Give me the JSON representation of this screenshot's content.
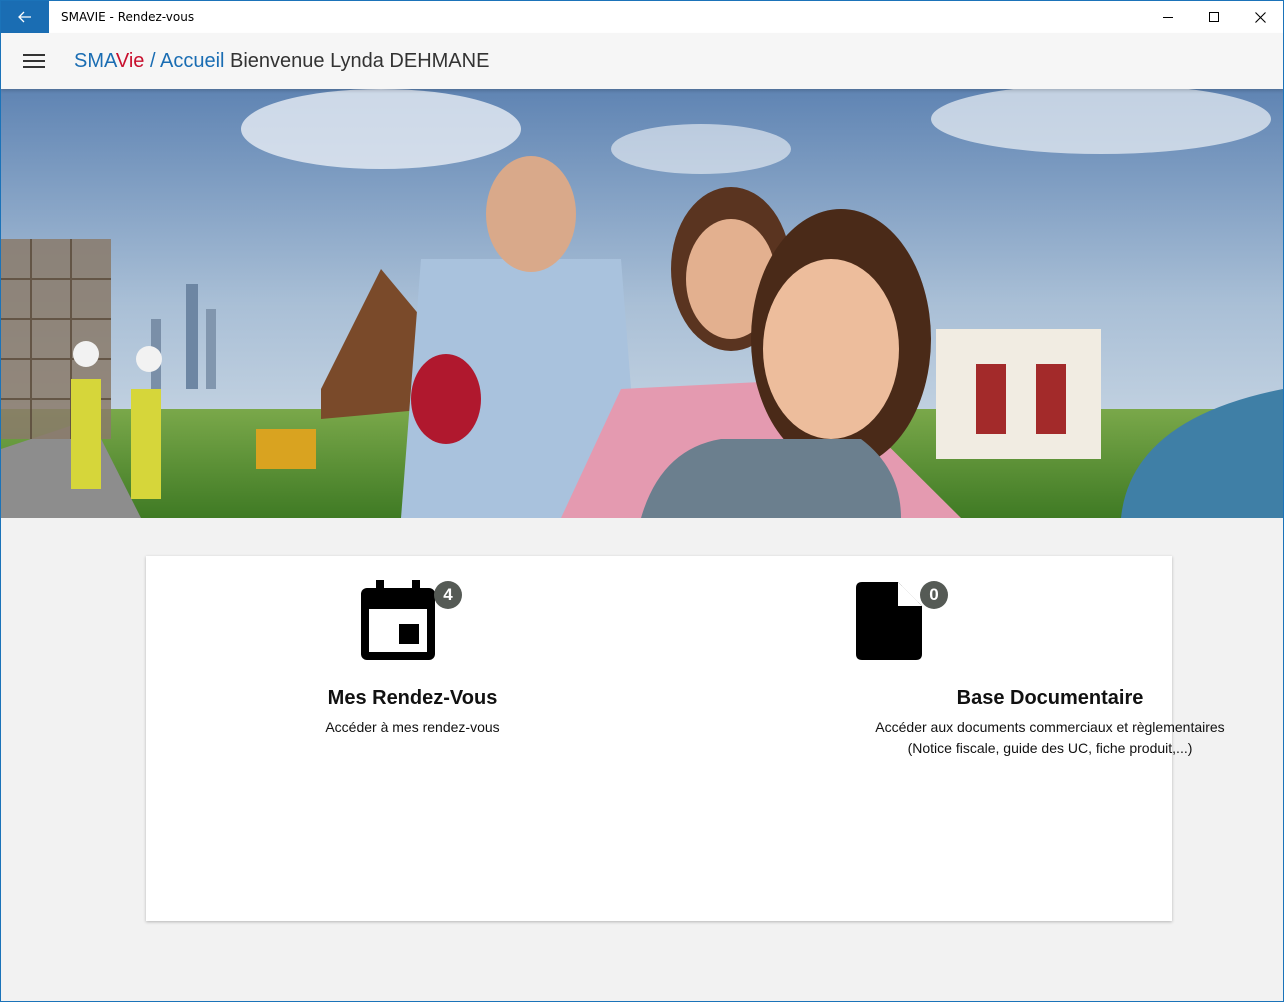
{
  "window": {
    "title": "SMAVIE - Rendez-vous"
  },
  "header": {
    "brand_sma": "SMA",
    "brand_vie": "Vie",
    "separator": " / ",
    "page": "Accueil",
    "welcome": " Bienvenue Lynda DEHMANE"
  },
  "tiles": [
    {
      "icon": "calendar-icon",
      "badge": "4",
      "title": "Mes Rendez-Vous",
      "description": "Accéder à mes rendez-vous"
    },
    {
      "icon": "document-icon",
      "badge": "0",
      "title": "Base Documentaire",
      "description_line1": "Accéder aux documents commerciaux et règlementaires",
      "description_line2": "(Notice fiscale, guide des UC, fiche produit,...)"
    }
  ],
  "colors": {
    "accent_blue": "#1a6db3",
    "brand_red": "#c8102e",
    "badge_gray": "#555a55"
  }
}
